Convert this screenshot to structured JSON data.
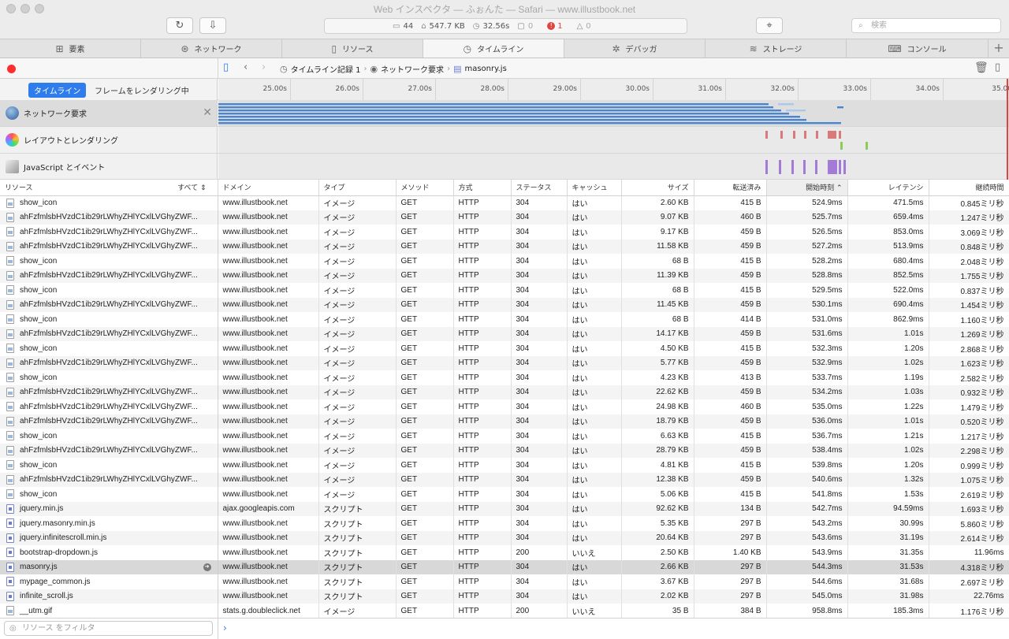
{
  "window": {
    "title": "Web インスペクタ — ふぉんた — Safari — www.illustbook.net"
  },
  "toolbar": {
    "reload_icon": "↻",
    "download_icon": "⇩",
    "target_icon": "⌖"
  },
  "status": {
    "resources": "44",
    "size": "547.7 KB",
    "time": "32.56s",
    "logs": "0",
    "errors": "1",
    "warnings": "0"
  },
  "search": {
    "placeholder": "検索"
  },
  "tabs": [
    {
      "label": "要素",
      "icon": "elements-icon"
    },
    {
      "label": "ネットワーク",
      "icon": "network-icon"
    },
    {
      "label": "リソース",
      "icon": "resources-icon"
    },
    {
      "label": "タイムライン",
      "icon": "timelines-icon"
    },
    {
      "label": "デバッガ",
      "icon": "debugger-icon"
    },
    {
      "label": "ストレージ",
      "icon": "storage-icon"
    },
    {
      "label": "コンソール",
      "icon": "console-icon"
    }
  ],
  "breadcrumb": [
    "タイムライン記録 1",
    "ネットワーク要求",
    "masonry.js"
  ],
  "mode": {
    "timeline": "タイムライン",
    "frames": "フレームをレンダリング中"
  },
  "ruler": [
    "25.00s",
    "26.00s",
    "27.00s",
    "28.00s",
    "29.00s",
    "30.00s",
    "31.00s",
    "32.00s",
    "33.00s",
    "34.00s",
    "35.00"
  ],
  "tracks": [
    {
      "label": "ネットワーク要求",
      "color": "#3f7ed9"
    },
    {
      "label": "レイアウトとレンダリング",
      "color": "#d96a6a"
    },
    {
      "label": "JavaScript とイベント",
      "color": "#a070d0"
    }
  ],
  "columns": {
    "resource": "リソース",
    "all": "すべて",
    "domain": "ドメイン",
    "type": "タイプ",
    "method": "メソッド",
    "scheme": "方式",
    "status": "ステータス",
    "cache": "キャッシュ",
    "size": "サイズ",
    "transferred": "転送済み",
    "start": "開始時刻",
    "latency": "レイテンシ",
    "duration": "継続時間"
  },
  "rows": [
    [
      "show_icon",
      "www.illustbook.net",
      "イメージ",
      "GET",
      "HTTP",
      "304",
      "はい",
      "2.60 KB",
      "415 B",
      "524.9ms",
      "471.5ms",
      "0.845ミリ秒",
      "img"
    ],
    [
      "ahFzfmlsbHVzdC1ib29rLWhyZHlYCxlLVGhyZWF...",
      "www.illustbook.net",
      "イメージ",
      "GET",
      "HTTP",
      "304",
      "はい",
      "9.07 KB",
      "460 B",
      "525.7ms",
      "659.4ms",
      "1.247ミリ秒",
      "img"
    ],
    [
      "ahFzfmlsbHVzdC1ib29rLWhyZHlYCxlLVGhyZWF...",
      "www.illustbook.net",
      "イメージ",
      "GET",
      "HTTP",
      "304",
      "はい",
      "9.17 KB",
      "459 B",
      "526.5ms",
      "853.0ms",
      "3.069ミリ秒",
      "img"
    ],
    [
      "ahFzfmlsbHVzdC1ib29rLWhyZHlYCxlLVGhyZWF...",
      "www.illustbook.net",
      "イメージ",
      "GET",
      "HTTP",
      "304",
      "はい",
      "11.58 KB",
      "459 B",
      "527.2ms",
      "513.9ms",
      "0.848ミリ秒",
      "img"
    ],
    [
      "show_icon",
      "www.illustbook.net",
      "イメージ",
      "GET",
      "HTTP",
      "304",
      "はい",
      "68 B",
      "415 B",
      "528.2ms",
      "680.4ms",
      "2.048ミリ秒",
      "img"
    ],
    [
      "ahFzfmlsbHVzdC1ib29rLWhyZHlYCxlLVGhyZWF...",
      "www.illustbook.net",
      "イメージ",
      "GET",
      "HTTP",
      "304",
      "はい",
      "11.39 KB",
      "459 B",
      "528.8ms",
      "852.5ms",
      "1.755ミリ秒",
      "img"
    ],
    [
      "show_icon",
      "www.illustbook.net",
      "イメージ",
      "GET",
      "HTTP",
      "304",
      "はい",
      "68 B",
      "415 B",
      "529.5ms",
      "522.0ms",
      "0.837ミリ秒",
      "img"
    ],
    [
      "ahFzfmlsbHVzdC1ib29rLWhyZHlYCxlLVGhyZWF...",
      "www.illustbook.net",
      "イメージ",
      "GET",
      "HTTP",
      "304",
      "はい",
      "11.45 KB",
      "459 B",
      "530.1ms",
      "690.4ms",
      "1.454ミリ秒",
      "img"
    ],
    [
      "show_icon",
      "www.illustbook.net",
      "イメージ",
      "GET",
      "HTTP",
      "304",
      "はい",
      "68 B",
      "414 B",
      "531.0ms",
      "862.9ms",
      "1.160ミリ秒",
      "img"
    ],
    [
      "ahFzfmlsbHVzdC1ib29rLWhyZHlYCxlLVGhyZWF...",
      "www.illustbook.net",
      "イメージ",
      "GET",
      "HTTP",
      "304",
      "はい",
      "14.17 KB",
      "459 B",
      "531.6ms",
      "1.01s",
      "1.269ミリ秒",
      "img"
    ],
    [
      "show_icon",
      "www.illustbook.net",
      "イメージ",
      "GET",
      "HTTP",
      "304",
      "はい",
      "4.50 KB",
      "415 B",
      "532.3ms",
      "1.20s",
      "2.868ミリ秒",
      "img"
    ],
    [
      "ahFzfmlsbHVzdC1ib29rLWhyZHlYCxlLVGhyZWF...",
      "www.illustbook.net",
      "イメージ",
      "GET",
      "HTTP",
      "304",
      "はい",
      "5.77 KB",
      "459 B",
      "532.9ms",
      "1.02s",
      "1.623ミリ秒",
      "img"
    ],
    [
      "show_icon",
      "www.illustbook.net",
      "イメージ",
      "GET",
      "HTTP",
      "304",
      "はい",
      "4.23 KB",
      "413 B",
      "533.7ms",
      "1.19s",
      "2.582ミリ秒",
      "img"
    ],
    [
      "ahFzfmlsbHVzdC1ib29rLWhyZHlYCxlLVGhyZWF...",
      "www.illustbook.net",
      "イメージ",
      "GET",
      "HTTP",
      "304",
      "はい",
      "22.62 KB",
      "459 B",
      "534.2ms",
      "1.03s",
      "0.932ミリ秒",
      "img"
    ],
    [
      "ahFzfmlsbHVzdC1ib29rLWhyZHlYCxlLVGhyZWF...",
      "www.illustbook.net",
      "イメージ",
      "GET",
      "HTTP",
      "304",
      "はい",
      "24.98 KB",
      "460 B",
      "535.0ms",
      "1.22s",
      "1.479ミリ秒",
      "img"
    ],
    [
      "ahFzfmlsbHVzdC1ib29rLWhyZHlYCxlLVGhyZWF...",
      "www.illustbook.net",
      "イメージ",
      "GET",
      "HTTP",
      "304",
      "はい",
      "18.79 KB",
      "459 B",
      "536.0ms",
      "1.01s",
      "0.520ミリ秒",
      "img"
    ],
    [
      "show_icon",
      "www.illustbook.net",
      "イメージ",
      "GET",
      "HTTP",
      "304",
      "はい",
      "6.63 KB",
      "415 B",
      "536.7ms",
      "1.21s",
      "1.217ミリ秒",
      "img"
    ],
    [
      "ahFzfmlsbHVzdC1ib29rLWhyZHlYCxlLVGhyZWF...",
      "www.illustbook.net",
      "イメージ",
      "GET",
      "HTTP",
      "304",
      "はい",
      "28.79 KB",
      "459 B",
      "538.4ms",
      "1.02s",
      "2.298ミリ秒",
      "img"
    ],
    [
      "show_icon",
      "www.illustbook.net",
      "イメージ",
      "GET",
      "HTTP",
      "304",
      "はい",
      "4.81 KB",
      "415 B",
      "539.8ms",
      "1.20s",
      "0.999ミリ秒",
      "img"
    ],
    [
      "ahFzfmlsbHVzdC1ib29rLWhyZHlYCxlLVGhyZWF...",
      "www.illustbook.net",
      "イメージ",
      "GET",
      "HTTP",
      "304",
      "はい",
      "12.38 KB",
      "459 B",
      "540.6ms",
      "1.32s",
      "1.075ミリ秒",
      "img"
    ],
    [
      "show_icon",
      "www.illustbook.net",
      "イメージ",
      "GET",
      "HTTP",
      "304",
      "はい",
      "5.06 KB",
      "415 B",
      "541.8ms",
      "1.53s",
      "2.619ミリ秒",
      "img"
    ],
    [
      "jquery.min.js",
      "ajax.googleapis.com",
      "スクリプト",
      "GET",
      "HTTP",
      "304",
      "はい",
      "92.62 KB",
      "134 B",
      "542.7ms",
      "94.59ms",
      "1.693ミリ秒",
      "js"
    ],
    [
      "jquery.masonry.min.js",
      "www.illustbook.net",
      "スクリプト",
      "GET",
      "HTTP",
      "304",
      "はい",
      "5.35 KB",
      "297 B",
      "543.2ms",
      "30.99s",
      "5.860ミリ秒",
      "js"
    ],
    [
      "jquery.infinitescroll.min.js",
      "www.illustbook.net",
      "スクリプト",
      "GET",
      "HTTP",
      "304",
      "はい",
      "20.64 KB",
      "297 B",
      "543.6ms",
      "31.19s",
      "2.614ミリ秒",
      "js"
    ],
    [
      "bootstrap-dropdown.js",
      "www.illustbook.net",
      "スクリプト",
      "GET",
      "HTTP",
      "200",
      "いいえ",
      "2.50 KB",
      "1.40 KB",
      "543.9ms",
      "31.35s",
      "11.96ms",
      "js"
    ],
    [
      "masonry.js",
      "www.illustbook.net",
      "スクリプト",
      "GET",
      "HTTP",
      "304",
      "はい",
      "2.66 KB",
      "297 B",
      "544.3ms",
      "31.53s",
      "4.318ミリ秒",
      "js"
    ],
    [
      "mypage_common.js",
      "www.illustbook.net",
      "スクリプト",
      "GET",
      "HTTP",
      "304",
      "はい",
      "3.67 KB",
      "297 B",
      "544.6ms",
      "31.68s",
      "2.697ミリ秒",
      "js"
    ],
    [
      "infinite_scroll.js",
      "www.illustbook.net",
      "スクリプト",
      "GET",
      "HTTP",
      "304",
      "はい",
      "2.02 KB",
      "297 B",
      "545.0ms",
      "31.98s",
      "22.76ms",
      "js"
    ],
    [
      "__utm.gif",
      "stats.g.doubleclick.net",
      "イメージ",
      "GET",
      "HTTP",
      "200",
      "いいえ",
      "35 B",
      "384 B",
      "958.8ms",
      "185.3ms",
      "1.176ミリ秒",
      "img"
    ]
  ],
  "selected_row": 25,
  "filter": {
    "placeholder": "リソース をフィルタ"
  }
}
